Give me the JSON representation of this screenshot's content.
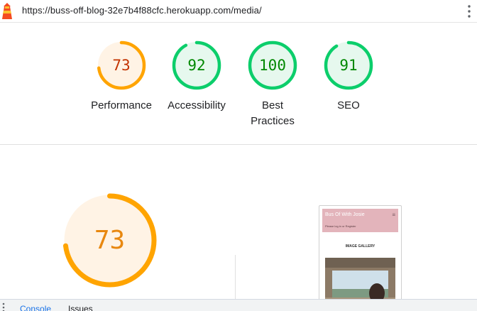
{
  "url_bar": {
    "url": "https://buss-off-blog-32e7b4f88cfc.herokuapp.com/media/",
    "logo_icon": "lighthouse-icon",
    "menu_icon": "kebab-menu-icon"
  },
  "scores": [
    {
      "label": "Performance",
      "value": "73",
      "score": 73,
      "status": "average"
    },
    {
      "label": "Accessibility",
      "value": "92",
      "score": 92,
      "status": "pass"
    },
    {
      "label": "Best Practices",
      "value": "100",
      "score": 100,
      "status": "pass"
    },
    {
      "label": "SEO",
      "value": "91",
      "score": 91,
      "status": "pass"
    }
  ],
  "detail": {
    "value": "73",
    "score": 73,
    "status": "average"
  },
  "thumbnail": {
    "brand": "Bus Of With Josie",
    "menu_icon": "hamburger-icon",
    "subtext": "Please log in or Register",
    "heading": "IMAGE GALLERY"
  },
  "drawer": {
    "tabs": [
      {
        "label": "Console",
        "active": true
      },
      {
        "label": "Issues",
        "active": false
      }
    ]
  },
  "colors": {
    "average_stroke": "#ffa400",
    "average_fill": "#fff3e5",
    "average_text": "#c33300",
    "average_text_big": "#e8870f",
    "pass_stroke": "#0cce6b",
    "pass_fill": "#e6f8ee",
    "pass_text": "#008800",
    "accent_link": "#1a73e8"
  }
}
